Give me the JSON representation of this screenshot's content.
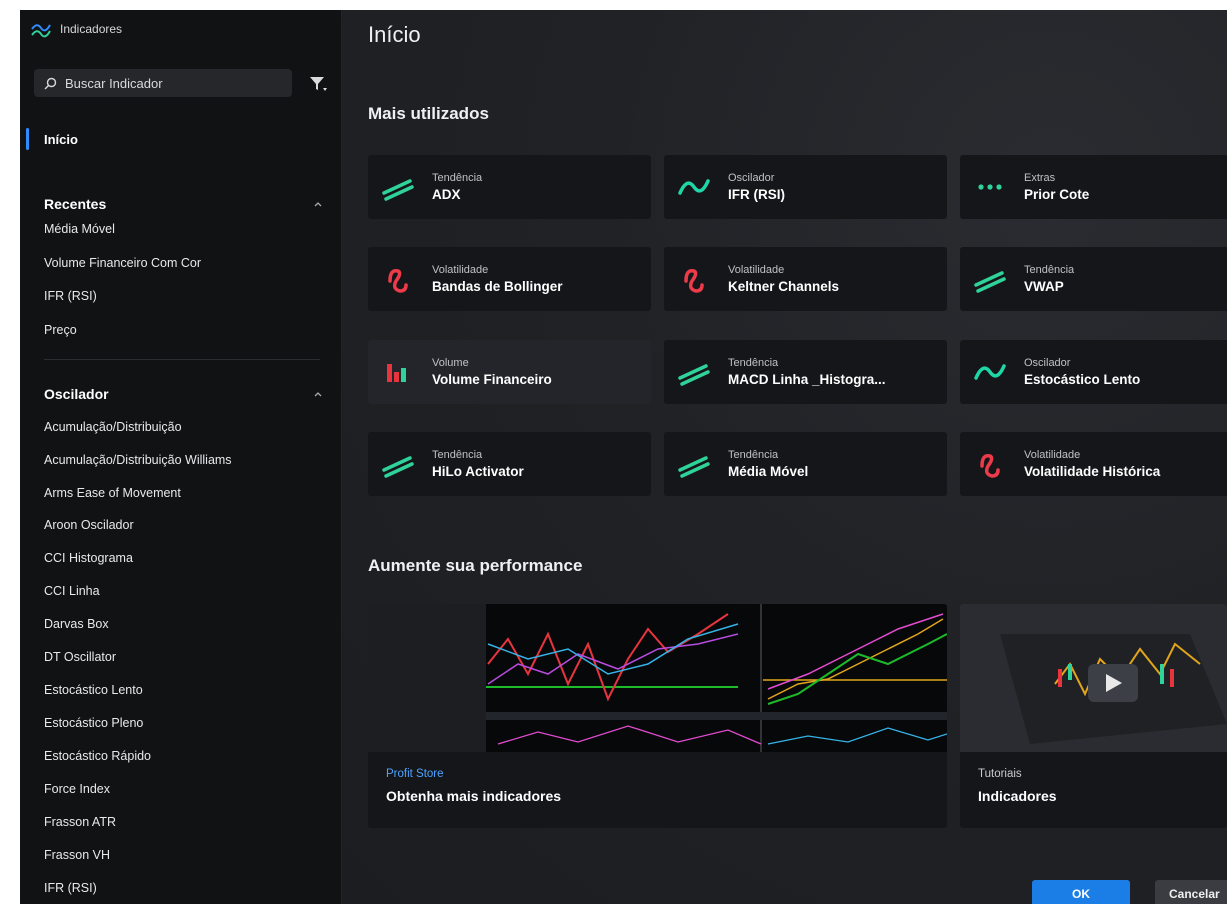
{
  "app": {
    "title": "Indicadores"
  },
  "search": {
    "placeholder": "Buscar Indicador"
  },
  "sidebar": {
    "home": "Início",
    "recent_header": "Recentes",
    "recent_items": [
      "Média Móvel",
      "Volume Financeiro Com Cor",
      "IFR (RSI)",
      "Preço"
    ],
    "osc_header": "Oscilador",
    "osc_items": [
      "Acumulação/Distribuição",
      "Acumulação/Distribuição Williams",
      "Arms Ease of Movement",
      "Aroon Oscilador",
      "CCI Histograma",
      "CCI Linha",
      "Darvas Box",
      "DT Oscillator",
      "Estocástico Lento",
      "Estocástico Pleno",
      "Estocástico Rápido",
      "Force Index",
      "Frasson ATR",
      "Frasson VH",
      "IFR (RSI)"
    ]
  },
  "main": {
    "title": "Início",
    "most_used_title": "Mais utilizados",
    "cards": [
      {
        "category": "Tendência",
        "name": "ADX",
        "icon": "trend-icon"
      },
      {
        "category": "Oscilador",
        "name": "IFR (RSI)",
        "icon": "oscillator-icon"
      },
      {
        "category": "Extras",
        "name": "Prior Cote",
        "icon": "extras-icon"
      },
      {
        "category": "Volatilidade",
        "name": "Bandas de Bollinger",
        "icon": "volatility-icon"
      },
      {
        "category": "Volatilidade",
        "name": "Keltner Channels",
        "icon": "volatility-icon"
      },
      {
        "category": "Tendência",
        "name": "VWAP",
        "icon": "trend-icon"
      },
      {
        "category": "Volume",
        "name": "Volume Financeiro",
        "icon": "volume-icon"
      },
      {
        "category": "Tendência",
        "name": "MACD Linha _Histogra...",
        "icon": "trend-icon"
      },
      {
        "category": "Oscilador",
        "name": "Estocástico Lento",
        "icon": "oscillator-icon"
      },
      {
        "category": "Tendência",
        "name": "HiLo Activator",
        "icon": "trend-icon"
      },
      {
        "category": "Tendência",
        "name": "Média Móvel",
        "icon": "trend-icon"
      },
      {
        "category": "Volatilidade",
        "name": "Volatilidade Histórica",
        "icon": "volatility-icon"
      }
    ],
    "performance_title": "Aumente sua performance",
    "banners": [
      {
        "category": "Profit Store",
        "name": "Obtenha mais indicadores"
      },
      {
        "category": "Tutoriais",
        "name": "Indicadores"
      }
    ]
  },
  "footer": {
    "ok": "OK",
    "cancel": "Cancelar"
  },
  "colors": {
    "accent": "#1a7ee6",
    "trend": "#2fd39a",
    "oscillator": "#1fd6a6",
    "volatility": "#ee3b4a",
    "volume": "#e8343d",
    "profit_store": "#4ea3ff"
  }
}
